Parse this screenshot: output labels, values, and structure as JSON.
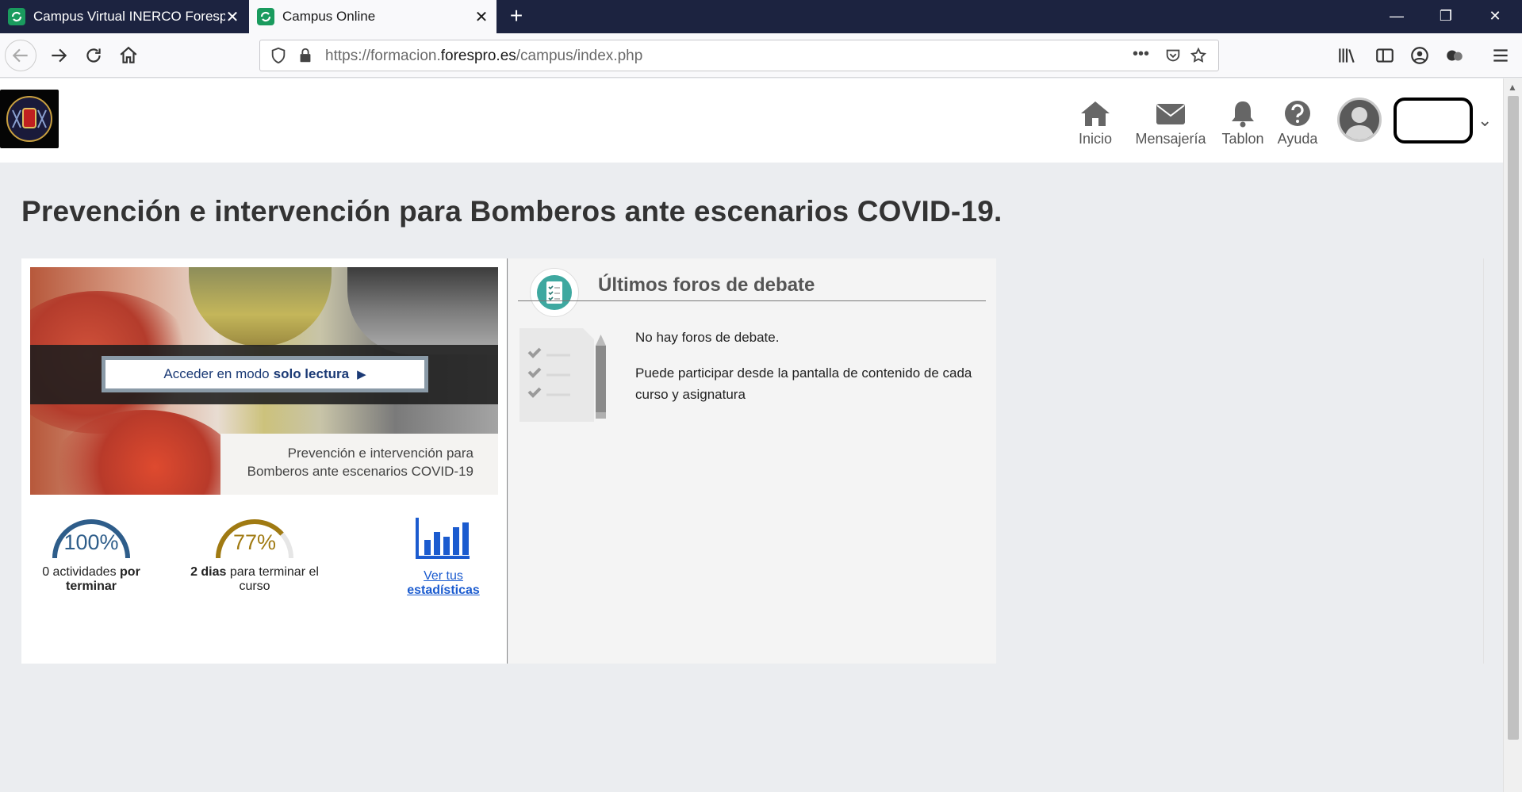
{
  "browser": {
    "tabs": [
      {
        "title": "Campus Virtual INERCO Foresp",
        "active": false
      },
      {
        "title": "Campus Online",
        "active": true
      }
    ],
    "url_prefix": "https://formacion.",
    "url_domain": "forespro.es",
    "url_path": "/campus/index.php"
  },
  "header": {
    "menu": [
      {
        "label": "Inicio",
        "icon": "home-icon"
      },
      {
        "label": "Mensajería",
        "icon": "envelope-icon"
      },
      {
        "label": "Tablon",
        "icon": "bell-icon"
      },
      {
        "label": "Ayuda",
        "icon": "help-icon"
      }
    ]
  },
  "course": {
    "title": "Prevención e intervención para Bomberos ante escenarios COVID-19.",
    "readonly_prefix": "Acceder en modo",
    "readonly_bold": "solo lectura",
    "banner_caption_line1": "Prevención e intervención para",
    "banner_caption_line2": "Bomberos ante escenarios COVID-19",
    "stats": {
      "activities_pct": "100%",
      "activities_value": 100,
      "activities_prefix": "0 actividades",
      "activities_bold": "por terminar",
      "days_pct": "77%",
      "days_value": 77,
      "days_bold": "2 dias",
      "days_rest": "para terminar el curso",
      "stats_link_line1": "Ver tus",
      "stats_link_line2": "estadísticas"
    }
  },
  "forums": {
    "title": "Últimos foros de debate",
    "empty": "No hay foros de debate.",
    "hint": "Puede participar desde la pantalla de contenido de cada curso y asignatura"
  },
  "colors": {
    "chrome_dark": "#1c2340",
    "gauge_blue": "#2e5d8a",
    "gauge_gold": "#a07a12",
    "link_blue": "#1b5bcf"
  }
}
